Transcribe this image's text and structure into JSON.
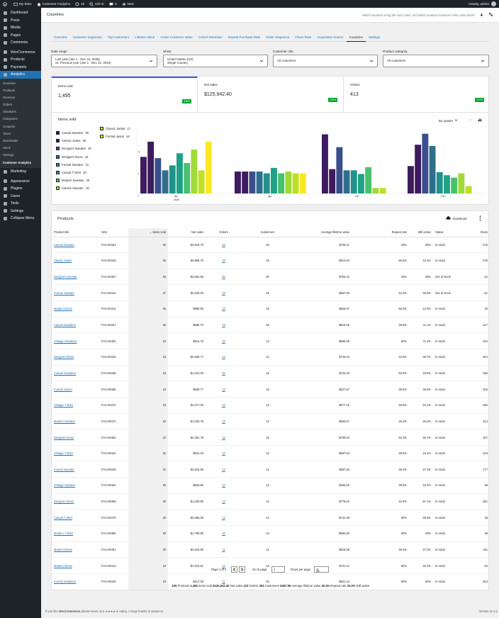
{
  "adminbar": {
    "site": "My Sites",
    "site2": "Customer Analytics",
    "updates": "19",
    "search": "Ctrl+K",
    "comments": "0",
    "new": "New",
    "howdy": "Howdy, admin"
  },
  "sidebar": {
    "items": [
      {
        "label": "Dashboard",
        "icon": "dashboard-icon"
      },
      {
        "label": "Posts",
        "icon": "pin-icon"
      },
      {
        "label": "Media",
        "icon": "media-icon"
      },
      {
        "label": "Pages",
        "icon": "page-icon"
      },
      {
        "label": "Comments",
        "icon": "comment-icon"
      },
      {
        "label": "WooCommerce",
        "icon": "woo-icon"
      },
      {
        "label": "Products",
        "icon": "products-icon"
      },
      {
        "label": "Payments",
        "icon": "payments-icon"
      },
      {
        "label": "Analytics",
        "icon": "analytics-icon"
      }
    ],
    "submenu": [
      "Overview",
      "Products",
      "Revenue",
      "Orders",
      "Variations",
      "Categories",
      "Coupons",
      "Taxes",
      "Downloads",
      "Stock",
      "Settings",
      "Customer Analytics"
    ],
    "items2": [
      {
        "label": "Marketing",
        "icon": "megaphone-icon"
      },
      {
        "label": "Appearance",
        "icon": "brush-icon"
      },
      {
        "label": "Plugins",
        "icon": "plugin-icon"
      },
      {
        "label": "Users",
        "icon": "users-icon"
      },
      {
        "label": "Tools",
        "icon": "tools-icon"
      },
      {
        "label": "Settings",
        "icon": "settings-icon"
      },
      {
        "label": "Collapse Menu",
        "icon": "collapse-icon"
      }
    ]
  },
  "header": {
    "title": "Countries",
    "tip": "Which countries bring the most sales, and which produce customers who come back?"
  },
  "tabs": [
    "Overview",
    "Customer Segments",
    "Top Customers",
    "Lifetime Value",
    "Active Customer Value",
    "Cohort Retention",
    "Repeat Purchase Rate",
    "Order Sequence",
    "Churn Rate",
    "Acquisition Source",
    "Countries",
    "Settings"
  ],
  "filters": {
    "date_label": "Date range",
    "date_line1": "Last year (Jan 1 - Dec 31, 2025)",
    "date_line2": "vs. Previous year (Jan 1 - Dec 31, 2024)",
    "show_label": "Show",
    "show_line1": "United States (US)",
    "show_line2": "Single Country",
    "role_label": "Customer role",
    "role_value": "All customers",
    "cat_label": "Product category",
    "cat_value": "All customers"
  },
  "metrics": [
    {
      "label": "Items sold",
      "value": "1,495",
      "delta": "349%"
    },
    {
      "label": "Net sales",
      "value": "$125,942.40",
      "delta": "319%"
    },
    {
      "label": "Orders",
      "value": "413",
      "delta": "317%"
    }
  ],
  "chart_header": {
    "title": "Items sold",
    "period": "By quarter"
  },
  "colors": {
    "accent": "#3858e9",
    "link": "#2271b1",
    "positive": "#00a32a",
    "sidebar": "#1d2327",
    "active_menu": "#2271b1"
  },
  "chart_data": {
    "type": "bar",
    "ylim": [
      0,
      10
    ],
    "yticks": [
      "0",
      "5",
      "10",
      "15"
    ],
    "categories": [
      "Jan\n2025",
      "Apr",
      "Jul",
      "Oct"
    ],
    "xtick_labels": [
      "Jan",
      "Apr",
      "Jul",
      "Oct"
    ],
    "xtick_sub": "2025",
    "series": [
      {
        "name": "Casual Sweater",
        "count": "30",
        "color": "#3d1b5e",
        "values": [
          6,
          3.6,
          9.7,
          4.5
        ]
      },
      {
        "name": "Classic Jeans",
        "count": "30",
        "color": "#3d1b5e",
        "values": [
          8.5,
          3.6,
          4,
          8
        ]
      },
      {
        "name": "Designer Sweater",
        "count": "20",
        "color": "#3b4e8c",
        "values": [
          5.8,
          3.6,
          7.6,
          9.8
        ]
      },
      {
        "name": "Designer Dress",
        "count": "23",
        "color": "#2f6f8e",
        "values": [
          3.8,
          3.6,
          3.8,
          7.8
        ]
      },
      {
        "name": "Formal Sweater",
        "count": "21",
        "color": "#22918a",
        "values": [
          4.6,
          3.3,
          3.8,
          3.5
        ]
      },
      {
        "name": "Casual T-Shirt",
        "count": "20",
        "color": "#1fa187",
        "values": [
          6.6,
          4.2,
          3.2,
          3
        ]
      },
      {
        "name": "Modern Sweater",
        "count": "20",
        "color": "#4ac16d",
        "values": [
          5,
          3.3,
          4.3,
          2.6
        ]
      },
      {
        "name": "Classic Sweater",
        "count": "19",
        "color": "#a0da39",
        "values": [
          7.2,
          3.6,
          0.9,
          3.3
        ]
      },
      {
        "name": "Classic Jacket",
        "count": "17",
        "color": "#bddf26",
        "values": [
          3.8,
          3.3,
          0.9,
          1.2
        ]
      },
      {
        "name": "Formal Jeans",
        "count": "16",
        "color": "#fde725",
        "values": [
          8.5,
          3.3,
          0,
          0
        ]
      }
    ]
  },
  "products": {
    "title": "Products",
    "download": "Download",
    "columns": [
      "Product title",
      "SKU",
      "Items sold",
      "Net sales",
      "Orders",
      "Customers",
      "Average lifetime value",
      "Repeat rate",
      "Still active",
      "Status",
      "Stock"
    ],
    "rows": [
      [
        "Casual Sweater",
        "FAS-00401",
        "30",
        "$2,819.70",
        "20",
        "20",
        "$709.41",
        "45%",
        "25%",
        "In stock",
        "275"
      ],
      [
        "Classic Jeans",
        "FAS-00445",
        "30",
        "$3,959.70",
        "19",
        "16",
        "$814.63",
        "55.6%",
        "44.4%",
        "In stock",
        "379"
      ],
      [
        "Designer Sweater",
        "FAS-00457",
        "28",
        "$3,681.55",
        "20",
        "20",
        "$753.22",
        "45%",
        "40%",
        "Out of stock",
        "-12"
      ],
      [
        "Formal Sweater",
        "FAS-00410",
        "27",
        "$2,025.00",
        "19",
        "18",
        "$657.80",
        "44.4%",
        "30.9%",
        "Out of stock",
        "-21"
      ],
      [
        "Modern Dress",
        "FAS-00414",
        "26",
        "$690.80",
        "16",
        "16",
        "$529.97",
        "56.3%",
        "12.5%",
        "In stock",
        "33"
      ],
      [
        "Casual Sweaters",
        "FAS-00437",
        "26",
        "$596.70",
        "19",
        "18",
        "$516.68",
        "38.9%",
        "11.1%",
        "In stock",
        "217"
      ],
      [
        "Vintage Sneakers",
        "FAS-00482",
        "24",
        "$815.76",
        "15",
        "14",
        "$556.86",
        "50%",
        "71.4%",
        "In stock",
        "232"
      ],
      [
        "Designer Dress",
        "FAS-00425",
        "23",
        "$2,560.77",
        "14",
        "14",
        "$748.02",
        "42.9%",
        "35.7%",
        "In stock",
        "354"
      ],
      [
        "Casual Sneakers",
        "FAS-00438",
        "23",
        "$1,012.00",
        "16",
        "16",
        "$722.20",
        "62.5%",
        "18.8%",
        "In stock",
        "285"
      ],
      [
        "Formal Jacket",
        "FAS-00456",
        "23",
        "$529.77",
        "14",
        "13",
        "$627.57",
        "38.5%",
        "38.5%",
        "In stock",
        "206"
      ],
      [
        "Vintage T-Shirt",
        "FAS-00472",
        "23",
        "$2,277.00",
        "13",
        "13",
        "$677.16",
        "30.8%",
        "23.1%",
        "In stock",
        "286"
      ],
      [
        "Modern Sweater",
        "FAS-00474",
        "22",
        "$1,033.78",
        "13",
        "13",
        "$653.67",
        "46.2%",
        "46.2%",
        "In stock",
        "314"
      ],
      [
        "Designer Dress",
        "FAS-00484",
        "22",
        "$2,281.78",
        "18",
        "15",
        "$709.63",
        "53.3%",
        "46.7%",
        "In stock",
        "207"
      ],
      [
        "Vintage T-Shirt",
        "FAS-00442",
        "21",
        "$934.29",
        "14",
        "13",
        "$587.63",
        "38.5%",
        "15.4%",
        "In stock",
        "218"
      ],
      [
        "Formal Sweater",
        "FAS-00446",
        "21",
        "$2,516.95",
        "13",
        "11",
        "$687.55",
        "36.4%",
        "27.3%",
        "In stock",
        "177"
      ],
      [
        "Vintage Sweater",
        "FAS-00454",
        "20",
        "$829.80",
        "13",
        "13",
        "$456.56",
        "38.5%",
        "15.4%",
        "In stock",
        "68"
      ],
      [
        "Designer Dress",
        "FAS-00465",
        "20",
        "$1,539.80",
        "14",
        "14",
        "$779.62",
        "42.9%",
        "57.1%",
        "In stock",
        "251"
      ],
      [
        "Casual T-Shirt",
        "FAS-00479",
        "20",
        "$2,559.80",
        "14",
        "14",
        "$731.38",
        "50%",
        "28.6%",
        "In stock",
        "49"
      ],
      [
        "Modern T-Shirt",
        "FAS-00480",
        "20",
        "$1,780.80",
        "10",
        "10",
        "$584.60",
        "30%",
        "40%",
        "In stock",
        "35"
      ],
      [
        "Modern Dress",
        "FAS-00491",
        "20",
        "$2,619.80",
        "11",
        "11",
        "$615.08",
        "45.5%",
        "27.3%",
        "In stock",
        "211"
      ],
      [
        "Modern Dress",
        "FAS-00413",
        "19",
        "$1,576.81",
        "12",
        "12",
        "$742.11",
        "50%",
        "33.3%",
        "In stock",
        "53"
      ],
      [
        "Formal Sneakers",
        "FAS-00434",
        "19",
        "$417.05",
        "11",
        "10",
        "$501.44",
        "50%",
        "20%",
        "In stock",
        "363"
      ],
      [
        "Modern Dress",
        "FAS-00444",
        "19",
        "$1,177.81",
        "14",
        "13",
        "$545.84",
        "30.8%",
        "53.8%",
        "In stock",
        "190"
      ],
      [
        "Classic Sweater",
        "FAS-00449",
        "19",
        "$2,755.00",
        "14",
        "12",
        "$692.40",
        "58.3%",
        "16.7%",
        "In stock",
        "305"
      ],
      [
        "Formal Jacket",
        "FAS-00460",
        "19",
        "$1,567.31",
        "16",
        "12",
        "$575.17",
        "33.3%",
        "50%",
        "In stock",
        "38"
      ]
    ],
    "pager": {
      "page_text": "Page 1 of 4",
      "goto": "Go to page",
      "page_value": "1",
      "per_page": "Rows per page",
      "per_value": "25"
    },
    "totals": [
      [
        "106",
        "Products"
      ],
      [
        "1,495",
        "Items sold"
      ],
      [
        "$125,942.40",
        "Net sales"
      ],
      [
        "413",
        "Orders"
      ],
      [
        "303",
        "Customers"
      ],
      [
        "$497.56",
        "Average lifetime value"
      ],
      [
        "30.4%",
        "Repeat rate"
      ],
      [
        "32.3%",
        "Still active"
      ]
    ]
  },
  "footer": {
    "text_pre": "If you like ",
    "brand": "WooCommerce",
    "text_mid": " please leave us a ",
    "stars": "★★★★★",
    "text_post": " rating. A huge thanks in advance!",
    "version": "Version 11.0.1"
  }
}
